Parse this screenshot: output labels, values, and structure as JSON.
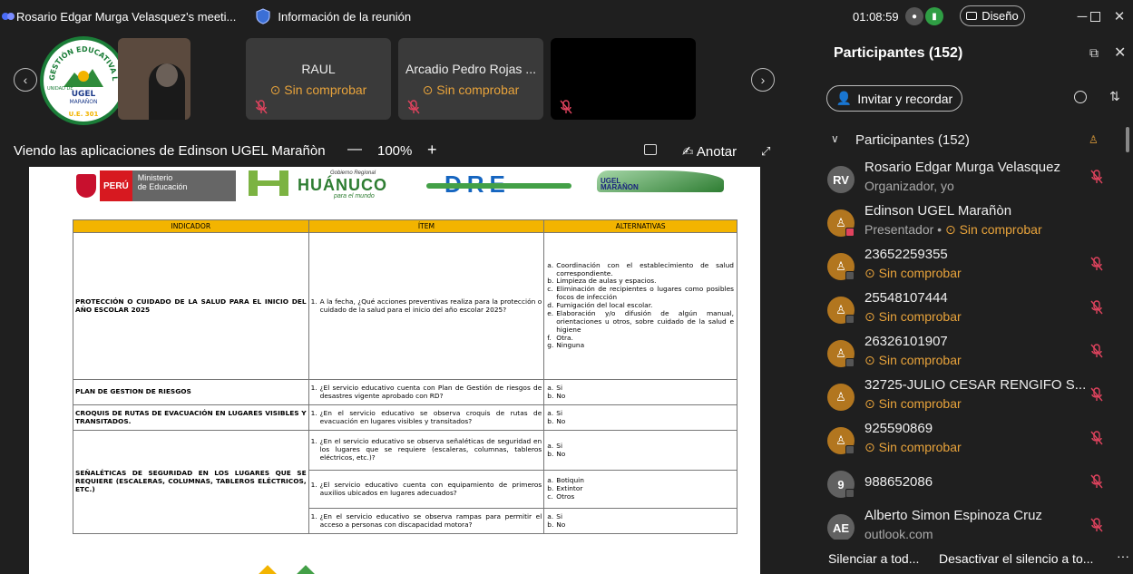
{
  "titlebar": {
    "meeting_title": "Rosario Edgar Murga Velasquez's meeti...",
    "info": "Información de la reunión",
    "timer": "01:08:59",
    "design": "Diseño"
  },
  "colors": {
    "status_warning": "#e8a33b",
    "mic_muted": "#e0435e",
    "header_yellow": "#f3b400"
  },
  "strip": {
    "tiles": [
      {
        "name": "RAUL",
        "status": "⊙ Sin comprobar"
      },
      {
        "name": "Arcadio Pedro Rojas ...",
        "status": "⊙ Sin comprobar"
      }
    ]
  },
  "share": {
    "label": "Viendo las aplicaciones de Edinson UGEL Marañòn",
    "zoom": "100%",
    "annotate": "Anotar"
  },
  "doc": {
    "peru": "PERÚ",
    "ministerio": "Ministerio",
    "de_educacion": "de Educación",
    "huanuco": "HUÁNUCO",
    "gobierno": "Gobierno Regional",
    "para_el_mundo": "para el mundo",
    "dre": "DRE",
    "ugel_marañon": "UGEL MARAÑON",
    "logo_ugel": "UGEL",
    "logo_maranon": "MARAÑON",
    "logo_ring": "GESTIÓN EDUCATIVA LOCAL",
    "logo_bottom": "U.E. 301",
    "logo_unidad": "UNIDAD DE"
  },
  "table": {
    "headers": [
      "INDICADOR",
      "ÍTEM",
      "ALTERNATIVAS"
    ],
    "r1": {
      "indicator": "PROTECCIÓN O CUIDADO DE LA SALUD PARA EL INICIO DEL AÑO ESCOLAR 2025",
      "n": "1.",
      "item": "A la fecha, ¿Qué acciones preventivas realiza para la protección o cuidado de la salud para el inicio del año escolar 2025?",
      "alts": [
        {
          "l": "a.",
          "t": "Coordinación con el establecimiento de salud correspondiente."
        },
        {
          "l": "b.",
          "t": "Limpieza de aulas y espacios."
        },
        {
          "l": "c.",
          "t": "Eliminación de recipientes o lugares como posibles focos de infección"
        },
        {
          "l": "d.",
          "t": "Fumigación del local escolar."
        },
        {
          "l": "e.",
          "t": "Elaboración y/o difusión de algún manual, orientaciones u otros, sobre cuidado de la salud e higiene"
        },
        {
          "l": "f.",
          "t": "Otra."
        },
        {
          "l": "g.",
          "t": "Ninguna"
        }
      ]
    },
    "r2": {
      "indicator": "PLAN DE GESTION DE RIESGOS",
      "n": "1.",
      "item": "¿El servicio educativo cuenta con Plan de Gestión de riesgos de desastres vigente aprobado con RD?",
      "a": "a.",
      "at": "Si",
      "b": "b.",
      "bt": "No"
    },
    "r3": {
      "indicator": "CROQUIS DE RUTAS DE EVACUACIÓN EN LUGARES VISIBLES Y TRANSITADOS.",
      "n": "1.",
      "item": "¿En el servicio educativo se observa croquis de rutas de evacuación en lugares visibles y transitados?",
      "a": "a.",
      "at": "Si",
      "b": "b.",
      "bt": "No"
    },
    "r4": {
      "indicator": "SEÑALÉTICAS DE SEGURIDAD EN LOS LUGARES QUE SE REQUIERE (ESCALERAS, COLUMNAS, TABLEROS ELÉCTRICOS, ETC.)",
      "s1": {
        "n": "1.",
        "item": "¿En el servicio educativo se observa señaléticas de seguridad en los lugares que se requiere (escaleras, columnas, tableros eléctricos, etc.)?",
        "a": "a.",
        "at": "Si",
        "b": "b.",
        "bt": "No"
      },
      "s2": {
        "n": "1.",
        "item": "¿El servicio educativo cuenta con equipamiento de primeros auxilios ubicados en lugares adecuados?",
        "a": "a.",
        "at": "Botiquin",
        "b": "b.",
        "bt": "Extintor",
        "c": "c.",
        "ct": "Otros"
      },
      "s3": {
        "n": "1.",
        "item": "¿En el servicio educativo se observa rampas para permitir el acceso a personas con discapacidad motora?",
        "a": "a.",
        "at": "Si",
        "b": "b.",
        "bt": "No"
      }
    }
  },
  "panel": {
    "title": "Participantes (152)",
    "invite": "Invitar y recordar",
    "section": "Participantes (152)",
    "participants": [
      {
        "initials": "RV",
        "name": "Rosario Edgar Murga Velasquez",
        "role": "Organizador, yo",
        "status": ""
      },
      {
        "initials": "",
        "name": "Edinson UGEL Marañòn",
        "role": "Presentador • ",
        "status": "⊙ Sin comprobar"
      },
      {
        "initials": "",
        "name": "23652259355",
        "role": "",
        "status": "⊙ Sin comprobar"
      },
      {
        "initials": "",
        "name": "25548107444",
        "role": "",
        "status": "⊙ Sin comprobar"
      },
      {
        "initials": "",
        "name": "26326101907",
        "role": "",
        "status": "⊙ Sin comprobar"
      },
      {
        "initials": "",
        "name": "32725-JULIO CESAR RENGIFO S...",
        "role": "",
        "status": "⊙ Sin comprobar"
      },
      {
        "initials": "",
        "name": "925590869",
        "role": "",
        "status": "⊙ Sin comprobar"
      },
      {
        "initials": "9",
        "name": "988652086",
        "role": "",
        "status": ""
      },
      {
        "initials": "AE",
        "name": "Alberto Simon Espinoza Cruz",
        "role": "outlook.com",
        "status": ""
      }
    ],
    "footer": {
      "mute_all": "Silenciar a tod...",
      "unmute_all": "Desactivar el silencio a to...",
      "more": "···"
    }
  }
}
